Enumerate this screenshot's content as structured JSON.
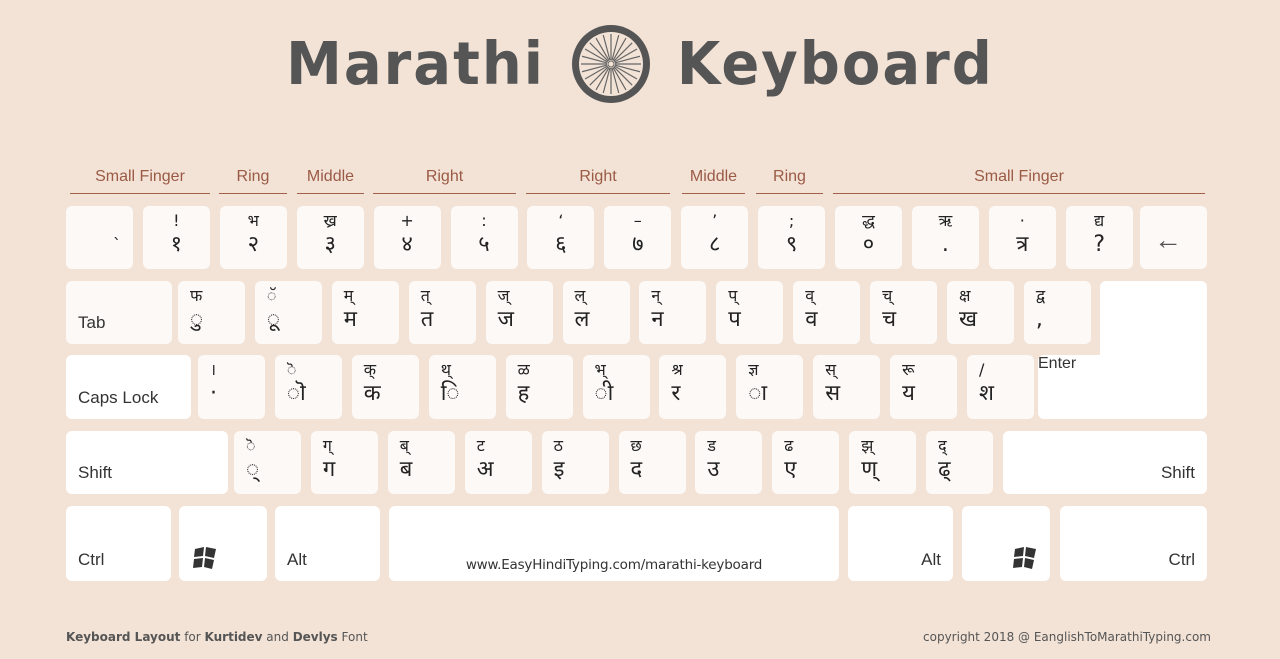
{
  "header": {
    "title_left": "Marathi",
    "title_right": "Keyboard",
    "emblem": "ashoka-chakra-icon"
  },
  "fingers": [
    {
      "label": "Small Finger"
    },
    {
      "label": "Ring"
    },
    {
      "label": "Middle"
    },
    {
      "label": "Right"
    },
    {
      "label": "Right"
    },
    {
      "label": "Middle"
    },
    {
      "label": "Ring"
    },
    {
      "label": "Small Finger"
    }
  ],
  "rows": {
    "number": [
      {
        "top": "",
        "bottom": "`"
      },
      {
        "top": "!",
        "bottom": "१"
      },
      {
        "top": "भ",
        "bottom": "२"
      },
      {
        "top": "ख्र",
        "bottom": "३"
      },
      {
        "top": "+",
        "bottom": "४"
      },
      {
        "top": ":",
        "bottom": "५"
      },
      {
        "top": "‘",
        "bottom": "६"
      },
      {
        "top": "–",
        "bottom": "७"
      },
      {
        "top": "’",
        "bottom": "८"
      },
      {
        "top": ";",
        "bottom": "९"
      },
      {
        "top": "द्ध",
        "bottom": "०"
      },
      {
        "top": "ऋ",
        "bottom": "."
      },
      {
        "top": "·",
        "bottom": "त्र"
      },
      {
        "top": "द्य",
        "bottom": "?"
      }
    ],
    "backspace": {
      "icon": "backspace-arrow-icon",
      "glyph": "←"
    },
    "tab_label": "Tab",
    "top": [
      {
        "top": "फ",
        "bottom": "ु"
      },
      {
        "top": "ॅ",
        "bottom": "ू"
      },
      {
        "top": "म्",
        "bottom": "म"
      },
      {
        "top": "त्",
        "bottom": "त"
      },
      {
        "top": "ज्",
        "bottom": "ज"
      },
      {
        "top": "ल्",
        "bottom": "ल"
      },
      {
        "top": "न्",
        "bottom": "न"
      },
      {
        "top": "प्",
        "bottom": "प"
      },
      {
        "top": "व्",
        "bottom": "व"
      },
      {
        "top": "च्",
        "bottom": "च"
      },
      {
        "top": "क्ष",
        "bottom": "ख"
      },
      {
        "top": "द्व",
        "bottom": ","
      }
    ],
    "caps_label": "Caps Lock",
    "home": [
      {
        "top": "।",
        "bottom": "·"
      },
      {
        "top": "ॆ",
        "bottom": "ॊ"
      },
      {
        "top": "क्",
        "bottom": "क"
      },
      {
        "top": "थ्",
        "bottom": "ि"
      },
      {
        "top": "ळ",
        "bottom": "ह"
      },
      {
        "top": "भ्",
        "bottom": "ी"
      },
      {
        "top": "श्र",
        "bottom": "र"
      },
      {
        "top": "ज्ञ",
        "bottom": "ा"
      },
      {
        "top": "स्",
        "bottom": "स"
      },
      {
        "top": "रू",
        "bottom": "य"
      },
      {
        "top": "/",
        "bottom": "श"
      }
    ],
    "enter_label": "Enter",
    "shift_left_label": "Shift",
    "bottom": [
      {
        "top": "ॆ",
        "bottom": "्"
      },
      {
        "top": "ग्",
        "bottom": "ग"
      },
      {
        "top": "ब्",
        "bottom": "ब"
      },
      {
        "top": "ट",
        "bottom": "अ"
      },
      {
        "top": "ठ",
        "bottom": "इ"
      },
      {
        "top": "छ",
        "bottom": "द"
      },
      {
        "top": "ड",
        "bottom": "उ"
      },
      {
        "top": "ढ",
        "bottom": "ए"
      },
      {
        "top": "झ्",
        "bottom": "ण्"
      },
      {
        "top": "द्",
        "bottom": "ढ्"
      }
    ],
    "shift_right_label": "Shift",
    "modifiers": {
      "ctrl_left": "Ctrl",
      "win_left": "windows-logo-icon",
      "alt_left": "Alt",
      "space_label": "www.EasyHindiTyping.com/marathi-keyboard",
      "alt_right": "Alt",
      "win_right": "windows-logo-icon",
      "ctrl_right": "Ctrl"
    }
  },
  "footer": {
    "left_b1": "Keyboard Layout",
    "left_t1": " for ",
    "left_b2": "Kurtidev",
    "left_t2": " and ",
    "left_b3": "Devlys",
    "left_t3": " Font",
    "right": "copyright 2018 @ EanglishToMarathiTyping.com"
  },
  "colors": {
    "background": "#f3e3d6",
    "key": "#fcf9f7",
    "finger_label": "#9a5a45",
    "title": "#555555"
  }
}
